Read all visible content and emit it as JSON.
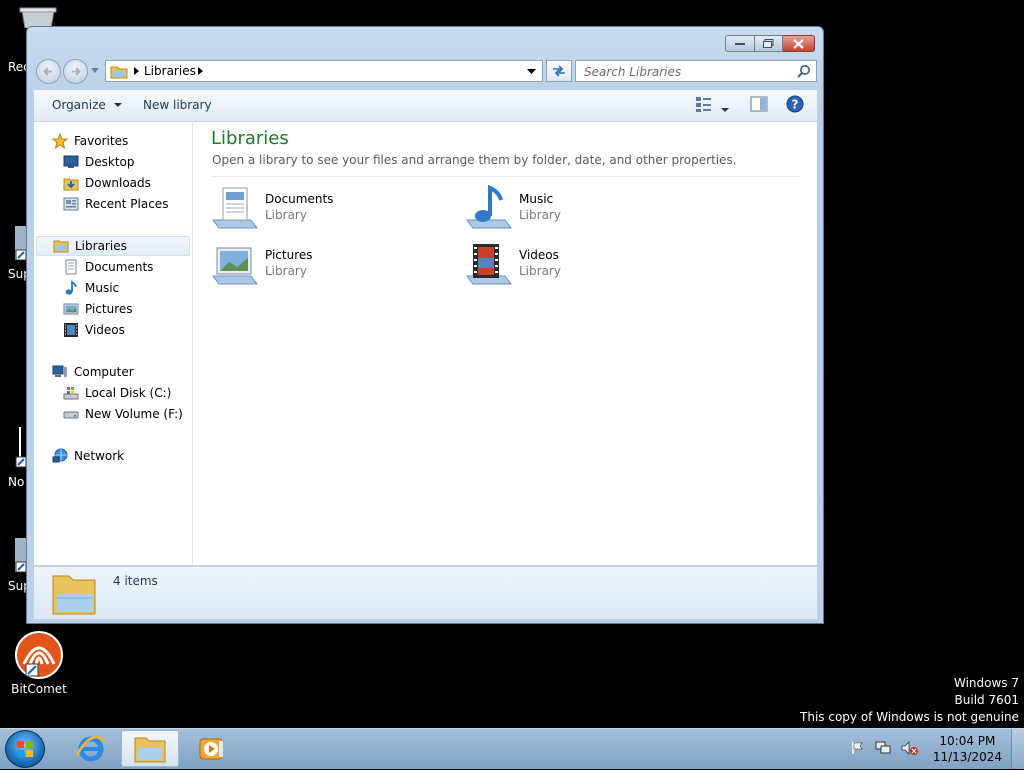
{
  "desktop": {
    "partial_labels": [
      "Rec",
      "Sup",
      "No",
      "Sup"
    ],
    "bitcomet_label": "BitComet",
    "watermark": [
      "Windows 7",
      "Build 7601",
      "This copy of Windows is not genuine"
    ]
  },
  "window": {
    "address": {
      "crumb": "Libraries"
    },
    "search": {
      "placeholder": "Search Libraries"
    },
    "toolbar": {
      "organize": "Organize",
      "new_library": "New library"
    },
    "nav": {
      "favorites": "Favorites",
      "desktop": "Desktop",
      "downloads": "Downloads",
      "recent_places": "Recent Places",
      "libraries": "Libraries",
      "documents": "Documents",
      "music": "Music",
      "pictures": "Pictures",
      "videos": "Videos",
      "computer": "Computer",
      "local_disk": "Local Disk (C:)",
      "new_volume": "New Volume (F:)",
      "network": "Network"
    },
    "content": {
      "title": "Libraries",
      "description": "Open a library to see your files and arrange them by folder, date, and other properties.",
      "items": [
        {
          "name": "Documents",
          "type": "Library",
          "icon": "documents-library-icon"
        },
        {
          "name": "Music",
          "type": "Library",
          "icon": "music-library-icon"
        },
        {
          "name": "Pictures",
          "type": "Library",
          "icon": "pictures-library-icon"
        },
        {
          "name": "Videos",
          "type": "Library",
          "icon": "videos-library-icon"
        }
      ]
    },
    "details": {
      "count": "4 items"
    }
  },
  "taskbar": {
    "clock": {
      "time": "10:04 PM",
      "date": "11/13/2024"
    }
  },
  "colors": {
    "title_green": "#1e7a2f",
    "taskbar": "#8fb0d0",
    "close_red": "#c0442e"
  }
}
